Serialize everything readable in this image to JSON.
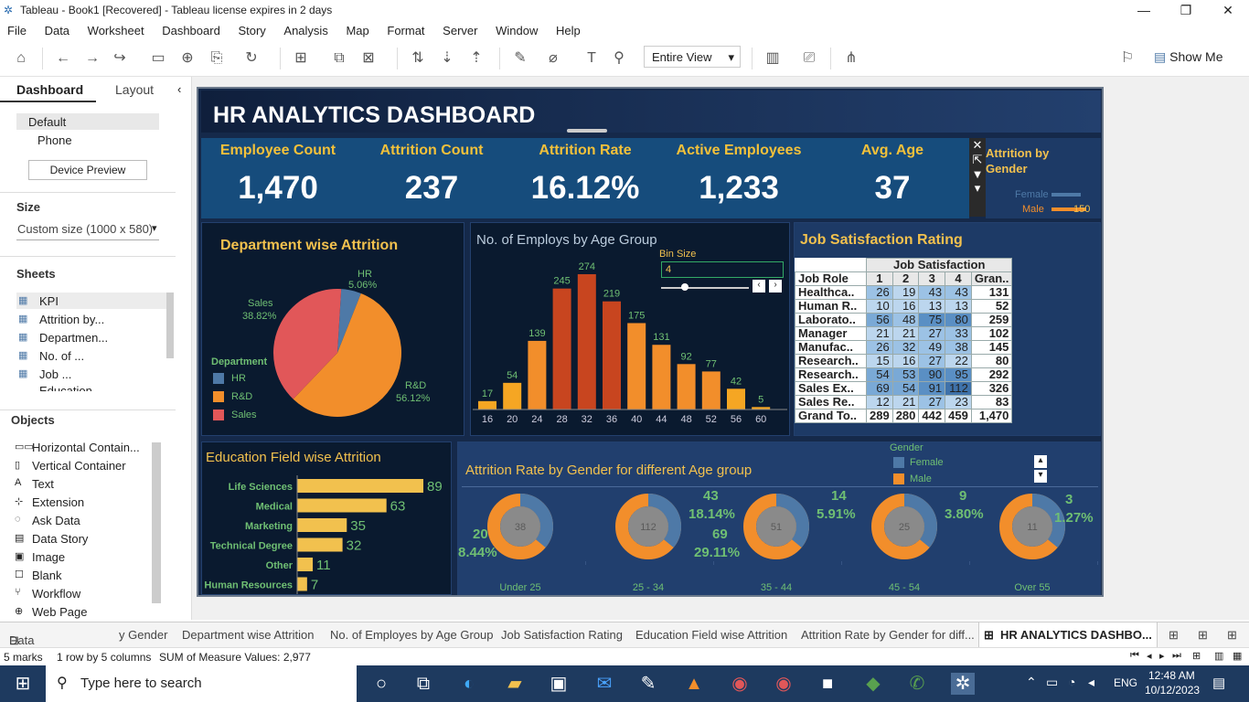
{
  "window": {
    "title": "Tableau - Book1 [Recovered] - Tableau license expires in 2 days"
  },
  "menu": [
    "File",
    "Data",
    "Worksheet",
    "Dashboard",
    "Story",
    "Analysis",
    "Map",
    "Format",
    "Server",
    "Window",
    "Help"
  ],
  "toolbar": {
    "view_select": "Entire View",
    "show_me": "Show Me"
  },
  "left": {
    "tab_dashboard": "Dashboard",
    "tab_layout": "Layout",
    "device_default": "Default",
    "device_phone": "Phone",
    "device_preview": "Device Preview",
    "size_label": "Size",
    "size_value": "Custom size (1000 x 580)",
    "sheets_label": "Sheets",
    "sheets": [
      "KPI",
      "Attrition by...",
      "Departmen...",
      "No. of ...",
      "Job ...",
      "Education..."
    ],
    "objects_label": "Objects",
    "objects": [
      "Horizontal Contain...",
      "Vertical Container",
      "Text",
      "Extension",
      "Ask Data",
      "Data Story",
      "Image",
      "Blank",
      "Workflow",
      "Web Page"
    ]
  },
  "dashboard": {
    "title": "HR ANALYTICS DASHBOARD",
    "kpis": [
      {
        "label": "Employee Count",
        "value": "1,470"
      },
      {
        "label": "Attrition Count",
        "value": "237"
      },
      {
        "label": "Attrition Rate",
        "value": "16.12%"
      },
      {
        "label": "Active Employees",
        "value": "1,233"
      },
      {
        "label": "Avg. Age",
        "value": "37"
      }
    ],
    "gender_filter": {
      "title": "Attrition by Gender",
      "female": "Female",
      "male": "Male",
      "male_value": "150"
    },
    "dept": {
      "title": "Department wise Attrition",
      "legend_title": "Department",
      "hr_label": "HR",
      "hr_pct": "5.06%",
      "rd_label": "R&D",
      "rd_pct": "56.12%",
      "sales_label": "Sales",
      "sales_pct": "38.82%",
      "legend": [
        "HR",
        "R&D",
        "Sales"
      ]
    },
    "age": {
      "title": "No. of Employs by Age Group",
      "bin_label": "Bin Size",
      "bin_value": "4"
    },
    "job": {
      "title": "Job Satisfaction Rating",
      "header": "Job Satisfaction",
      "row_header": "Job Role",
      "cols": [
        "1",
        "2",
        "3",
        "4",
        "Gran.."
      ],
      "rows": [
        [
          "Healthca..",
          "26",
          "19",
          "43",
          "43",
          "131"
        ],
        [
          "Human R..",
          "10",
          "16",
          "13",
          "13",
          "52"
        ],
        [
          "Laborato..",
          "56",
          "48",
          "75",
          "80",
          "259"
        ],
        [
          "Manager",
          "21",
          "21",
          "27",
          "33",
          "102"
        ],
        [
          "Manufac..",
          "26",
          "32",
          "49",
          "38",
          "145"
        ],
        [
          "Research..",
          "15",
          "16",
          "27",
          "22",
          "80"
        ],
        [
          "Research..",
          "54",
          "53",
          "90",
          "95",
          "292"
        ],
        [
          "Sales Ex..",
          "69",
          "54",
          "91",
          "112",
          "326"
        ],
        [
          "Sales Re..",
          "12",
          "21",
          "27",
          "23",
          "83"
        ],
        [
          "Grand To..",
          "289",
          "280",
          "442",
          "459",
          "1,470"
        ]
      ]
    },
    "edu": {
      "title": "Education Field wise Attrition"
    },
    "gender_age": {
      "title": "Attrition Rate by Gender for different Age group",
      "legend_title": "Gender",
      "legend": [
        "Female",
        "Male"
      ],
      "groups": [
        {
          "label": "Under 25",
          "center": "38",
          "count": "20",
          "rate": "8.44%"
        },
        {
          "label": "25 - 34",
          "center": "112",
          "count": "69",
          "rate": "29.11%"
        },
        {
          "label": "35 - 44",
          "center": "51",
          "count": "43",
          "rate": "18.14%"
        },
        {
          "label": "45 - 54",
          "center": "25",
          "count": "14",
          "rate": "5.91%"
        },
        {
          "label": "Over 55",
          "center": "11",
          "count": "9",
          "rate": "3.80%"
        }
      ],
      "extra": {
        "count": "3",
        "rate": "1.27%"
      }
    }
  },
  "sheet_tabs": [
    "Data Source",
    "y Gender",
    "Department wise Attrition",
    "No. of Employes by Age Group",
    "Job Satisfaction Rating",
    "Education Field wise Attrition",
    "Attrition Rate by Gender for diff...",
    "HR ANALYTICS DASHBO..."
  ],
  "status": {
    "marks": "5 marks",
    "rows": "1 row by 5 columns",
    "sum": "SUM of Measure Values: 2,977"
  },
  "taskbar": {
    "search": "Type here to search",
    "time": "12:48 AM",
    "date": "10/12/2023",
    "lang": "ENG"
  },
  "colors": {
    "orange": "#f28e2b",
    "blue": "#4e79a7",
    "red": "#e15759",
    "gold": "#f2c14e",
    "dark": "#15294a"
  },
  "chart_data": [
    {
      "type": "pie",
      "title": "Department wise Attrition",
      "categories": [
        "HR",
        "R&D",
        "Sales"
      ],
      "values": [
        5.06,
        56.12,
        38.82
      ]
    },
    {
      "type": "bar",
      "title": "No. of Employs by Age Group",
      "categories": [
        "16",
        "20",
        "24",
        "28",
        "32",
        "36",
        "40",
        "44",
        "48",
        "52",
        "56",
        "60"
      ],
      "values": [
        17,
        54,
        139,
        245,
        274,
        219,
        175,
        131,
        92,
        77,
        42,
        5
      ]
    },
    {
      "type": "bar",
      "title": "Education Field wise Attrition",
      "categories": [
        "Life Sciences",
        "Medical",
        "Marketing",
        "Technical Degree",
        "Other",
        "Human Resources"
      ],
      "values": [
        89,
        63,
        35,
        32,
        11,
        7
      ]
    }
  ]
}
